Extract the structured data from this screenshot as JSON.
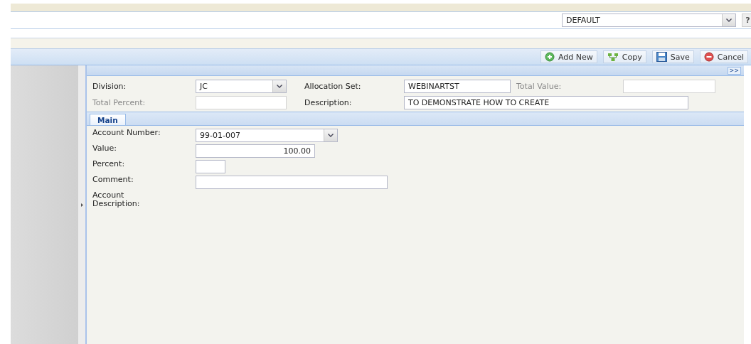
{
  "profile_select": {
    "value": "DEFAULT"
  },
  "help_button": {
    "label": "?"
  },
  "toolbar": {
    "buttons": [
      {
        "label": "Add New",
        "kind": "add"
      },
      {
        "label": "Copy",
        "kind": "copy"
      },
      {
        "label": "Save",
        "kind": "save"
      },
      {
        "label": "Cancel",
        "kind": "cancel"
      }
    ]
  },
  "expand_button": {
    "label": ">>"
  },
  "header_rows": [
    [
      {
        "label": "Division:",
        "value": "JC",
        "kind": "select",
        "disabled": false
      },
      {
        "label": "Allocation Set:",
        "value": "WEBINARTST",
        "kind": "text",
        "disabled": false
      },
      {
        "label": "Total Value:",
        "kind": "text",
        "disabled": true
      }
    ],
    [
      {
        "label": "Total Percent:",
        "kind": "text",
        "disabled": true
      },
      {
        "label": "Description:",
        "value": "TO DEMONSTRATE HOW TO CREATE",
        "kind": "text",
        "disabled": false
      }
    ]
  ],
  "tabs": [
    {
      "label": "Main",
      "selected": true
    }
  ],
  "detail_fields": [
    {
      "label": "Account Number:",
      "value": "99-01-007",
      "kind": "select"
    },
    {
      "label": "Value:",
      "value": "100.00",
      "kind": "number"
    },
    {
      "label": "Percent:",
      "kind": "text"
    },
    {
      "label": "Comment:",
      "kind": "text"
    },
    {
      "label": "Account Description:",
      "kind": "label"
    }
  ]
}
